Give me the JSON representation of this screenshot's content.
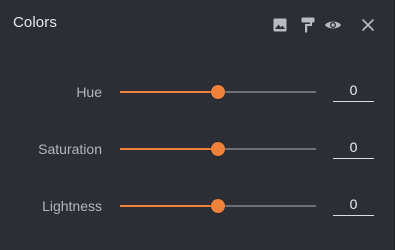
{
  "panel": {
    "title": "Colors",
    "icons": [
      "image-icon",
      "paint-roller-icon",
      "eye-icon",
      "close-icon"
    ]
  },
  "colors": {
    "accent": "#f0813a",
    "track": "#6c7078",
    "background": "#2b2e34"
  },
  "controls": [
    {
      "label": "Hue",
      "value": "0",
      "level": 0.5
    },
    {
      "label": "Saturation",
      "value": "0",
      "level": 0.5
    },
    {
      "label": "Lightness",
      "value": "0",
      "level": 0.5
    }
  ]
}
